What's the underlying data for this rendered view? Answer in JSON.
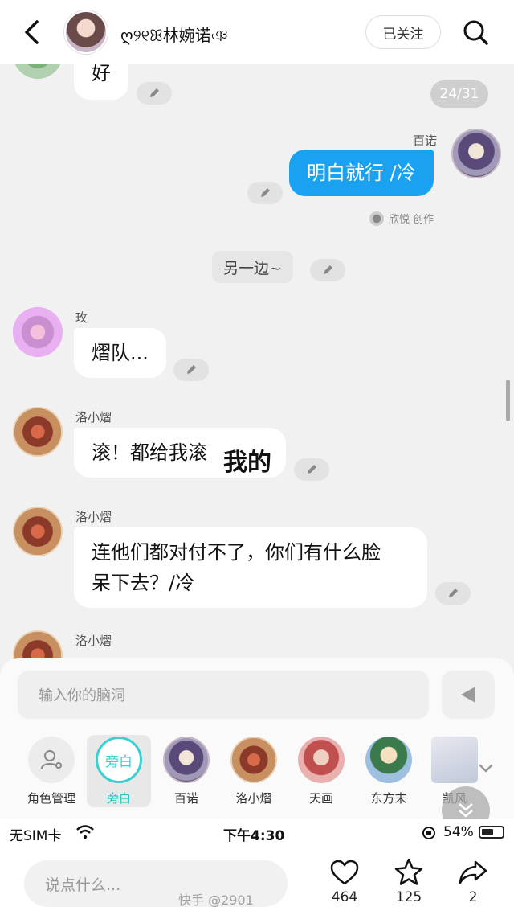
{
  "header": {
    "name": "ღ୨୧ꕤ林婉诺ঞ",
    "follow_label": "已关注"
  },
  "chat": {
    "counter": "24/31",
    "msg_hao": "好",
    "mine_sender": "百诺",
    "mine_text": "明白就行 /冷",
    "mine_note": "欣悦  创作",
    "narration": "另一边~",
    "msg2_sender": "玫",
    "msg2_text": "熠队...",
    "msg3_sender": "洛小熠",
    "msg3_text": "滚！都给我滚",
    "overlay_text": "我的",
    "msg4_sender": "洛小熠",
    "msg4_line1": "连他们都对付不了，你们有什么脸",
    "msg4_line2": "呆下去？/冷",
    "msg5_sender": "洛小熠"
  },
  "composer": {
    "placeholder": "输入你的脑洞"
  },
  "roles": [
    {
      "label": "角色管理",
      "icon": "role-manage-icon"
    },
    {
      "label": "旁白",
      "badge": "旁白"
    },
    {
      "label": "百诺"
    },
    {
      "label": "洛小熠"
    },
    {
      "label": "天画"
    },
    {
      "label": "东方末"
    },
    {
      "label": "凯风"
    }
  ],
  "status_bar": {
    "carrier": "无SIM卡",
    "time": "下午4:30",
    "battery": "54%"
  },
  "bottom_bar": {
    "comment_placeholder": "说点什么...",
    "like_count": "464",
    "star_count": "125",
    "share_count": "2",
    "watermark": "快手 @2901"
  },
  "colors": {
    "accent_blue": "#1aa1f0",
    "narration_teal": "#38d0d0"
  }
}
